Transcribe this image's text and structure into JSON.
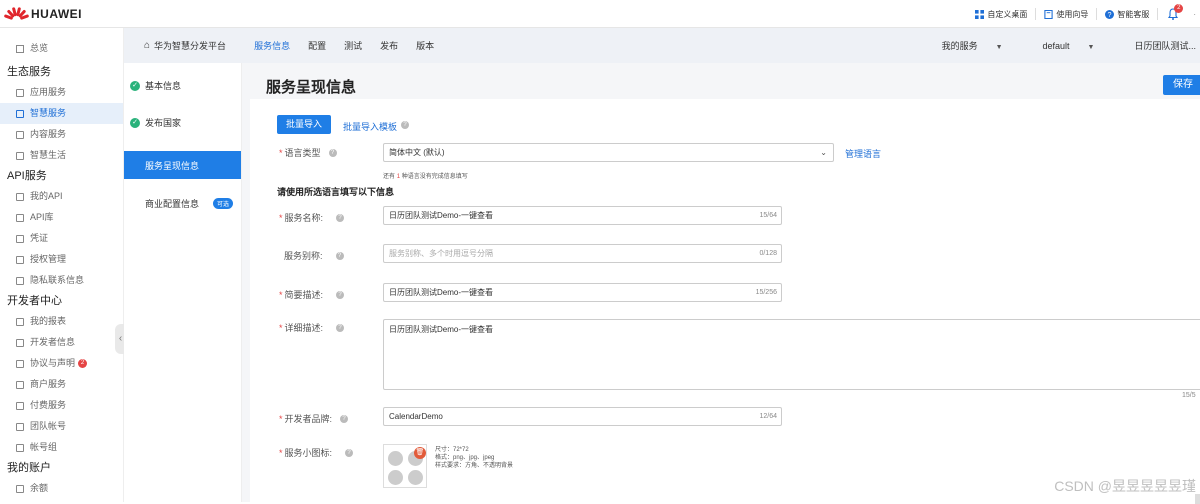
{
  "top": {
    "brand": "HUAWEI",
    "tools": [
      {
        "icon": "grid-icon",
        "label": "自定义桌面"
      },
      {
        "icon": "book-icon",
        "label": "使用向导"
      },
      {
        "icon": "help-icon",
        "label": "智能客服"
      }
    ],
    "bell_badge": "2",
    "more": "·"
  },
  "sidebar": {
    "overview": "总览",
    "sections": [
      {
        "title": "生态服务",
        "items": [
          {
            "label": "应用服务",
            "icon": "app-icon"
          },
          {
            "label": "智慧服务",
            "icon": "smart-icon",
            "active": true
          },
          {
            "label": "内容服务",
            "icon": "content-icon"
          },
          {
            "label": "智慧生活",
            "icon": "life-icon"
          }
        ]
      },
      {
        "title": "API服务",
        "items": [
          {
            "label": "我的API",
            "icon": "api-icon"
          },
          {
            "label": "API库",
            "icon": "cube-icon"
          },
          {
            "label": "凭证",
            "icon": "credential-icon"
          },
          {
            "label": "授权管理",
            "icon": "auth-icon"
          },
          {
            "label": "隐私联系信息",
            "icon": "privacy-icon"
          }
        ]
      },
      {
        "title": "开发者中心",
        "items": [
          {
            "label": "我的报表",
            "icon": "report-icon"
          },
          {
            "label": "开发者信息",
            "icon": "user-icon"
          },
          {
            "label": "协议与声明",
            "icon": "agreement-icon",
            "badge": "2"
          },
          {
            "label": "商户服务",
            "icon": "merchant-icon"
          },
          {
            "label": "付费服务",
            "icon": "payment-icon"
          },
          {
            "label": "团队帐号",
            "icon": "team-icon"
          },
          {
            "label": "帐号组",
            "icon": "group-icon"
          }
        ]
      },
      {
        "title": "我的账户",
        "items": [
          {
            "label": "余额",
            "icon": "balance-icon"
          }
        ]
      }
    ]
  },
  "subnav": {
    "home": "华为智慧分发平台",
    "tabs": [
      "服务信息",
      "配置",
      "测试",
      "发布",
      "版本"
    ],
    "active_tab": "服务信息",
    "my_service": "我的服务",
    "env": "default",
    "service_name": "日历团队测试..."
  },
  "leftnav": {
    "items": [
      {
        "label": "基本信息",
        "done": true
      },
      {
        "label": "发布国家",
        "done": true
      },
      {
        "label": "服务呈现信息",
        "active": true
      },
      {
        "label": "商业配置信息",
        "tag": "可选"
      }
    ]
  },
  "form": {
    "page_title": "服务呈现信息",
    "save": "保存",
    "batch_import": "批量导入",
    "batch_template": "批量导入模板",
    "lang_label": "语言类型",
    "lang_value": "简体中文 (默认)",
    "manage_lang": "管理语言",
    "notice_prefix": "还有",
    "notice_count": "1",
    "notice_suffix": "种语言没有完成信息填写",
    "hint": "请使用所选语言填写以下信息",
    "name_label": "服务名称:",
    "name_value": "日历团队测试Demo-一键查看",
    "name_count": "15/64",
    "alias_label": "服务别称:",
    "alias_placeholder": "服务别称、多个时用逗号分隔",
    "alias_count": "0/128",
    "brief_label": "简要描述:",
    "brief_value": "日历团队测试Demo-一键查看",
    "brief_count": "15/256",
    "detail_label": "详细描述:",
    "detail_value": "日历团队测试Demo-一键查看",
    "detail_count": "15/5",
    "brand_label": "开发者品牌:",
    "brand_value": "CalendarDemo",
    "brand_count": "12/64",
    "icon_label": "服务小图标:",
    "spec_size": "尺寸：72*72",
    "spec_format": "格式：png、jpg、jpeg",
    "spec_style": "样式要求：方角、不透明背景"
  },
  "watermark": "CSDN @昱昱昱昱昱瑾"
}
